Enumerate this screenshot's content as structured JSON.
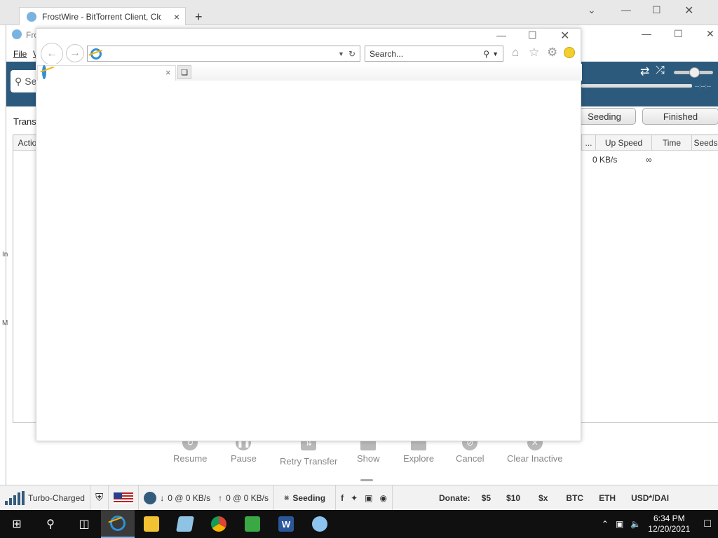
{
  "browser": {
    "tab_title": "FrostWire - BitTorrent Client, Clou",
    "new_tab": "+",
    "tab_close": "×"
  },
  "frostwire": {
    "title": "Fro",
    "menu": {
      "file": "File",
      "view": "V"
    },
    "search_placeholder": "Se",
    "transfers_label": "Transf",
    "filters": {
      "seeding": "Seeding",
      "finished": "Finished"
    },
    "time_display": "--:--:--",
    "columns": {
      "actions": "Actio",
      "dots": "...",
      "up_speed": "Up Speed",
      "time": "Time",
      "seeds": "Seeds"
    },
    "row": {
      "up_speed": "0 KB/s",
      "time": "∞"
    },
    "actions": {
      "resume": "Resume",
      "pause": "Pause",
      "retry": "Retry Transfer",
      "show": "Show",
      "explore": "Explore",
      "cancel": "Cancel",
      "clear": "Clear Inactive"
    },
    "left_edge": {
      "a": "In",
      "b": "M"
    }
  },
  "statusbar": {
    "turbo": "Turbo-Charged",
    "download": "0 @ 0 KB/s",
    "upload": "0 @ 0 KB/s",
    "seeding": "Seeding",
    "donate_label": "Donate:",
    "donate": [
      "$5",
      "$10",
      "$x",
      "BTC",
      "ETH",
      "USD*/DAI"
    ]
  },
  "ie": {
    "search_placeholder": "Search...",
    "address_value": ""
  },
  "taskbar": {
    "time": "6:34 PM",
    "date": "12/20/2021"
  },
  "colors": {
    "fw_toolbar": "#2c5a7d",
    "taskbar": "#101010"
  }
}
